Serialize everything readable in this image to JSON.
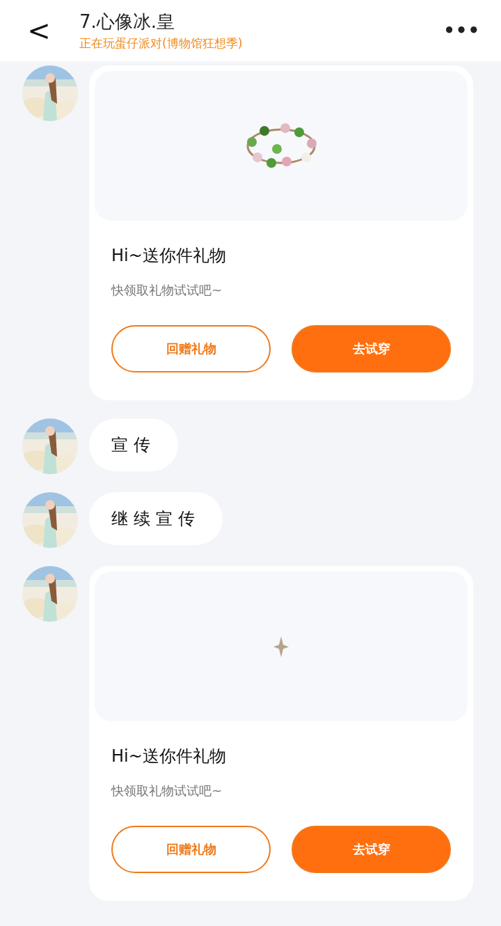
{
  "header": {
    "back": "<",
    "title": "7.心像冰.皇",
    "status": "正在玩蛋仔派对(博物馆狂想季)",
    "more": "•••"
  },
  "messages": [
    {
      "kind": "gift",
      "item": {
        "kind": "wreath"
      },
      "title": "Hi~送你件礼物",
      "subtitle": "快领取礼物试试吧~",
      "buttons": [
        {
          "label": "回赠礼物",
          "kind": "outline"
        },
        {
          "label": "去试穿",
          "kind": "filled"
        }
      ]
    },
    {
      "kind": "text",
      "text": "宣传"
    },
    {
      "kind": "text",
      "text": "继续宣传"
    },
    {
      "kind": "gift",
      "item": {
        "kind": "sparkle"
      },
      "title": "Hi~送你件礼物",
      "subtitle": "快领取礼物试试吧~",
      "buttons": [
        {
          "label": "回赠礼物",
          "kind": "outline"
        },
        {
          "label": "去试穿",
          "kind": "filled"
        }
      ]
    }
  ]
}
